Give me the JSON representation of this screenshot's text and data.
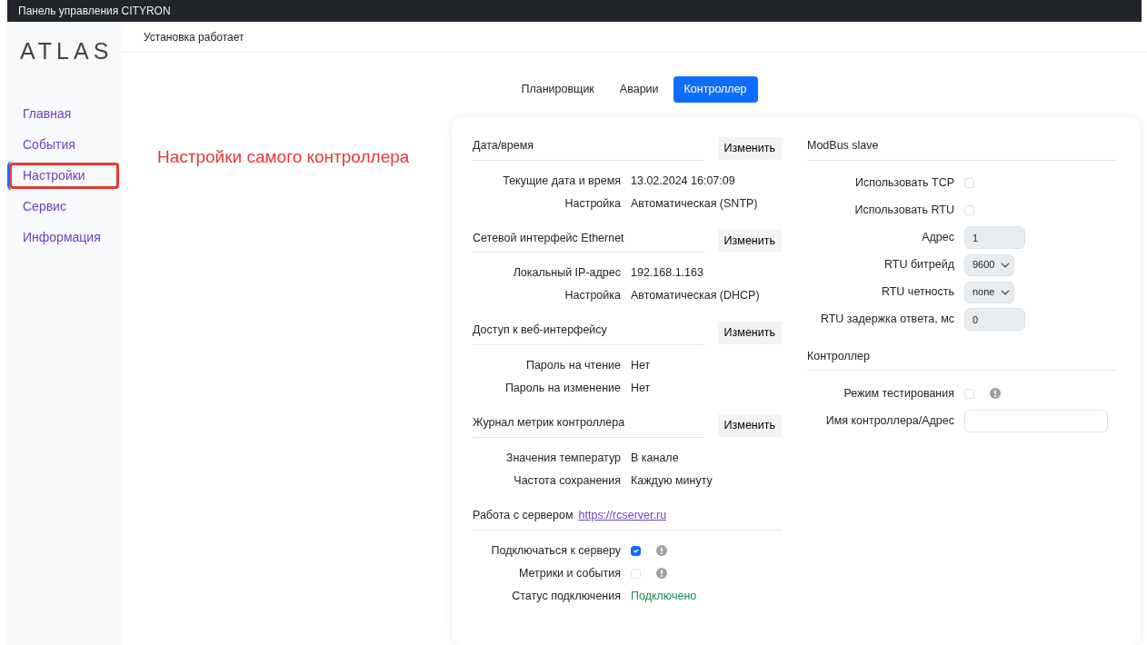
{
  "topbar": {
    "title": "Панель управления CITYRON"
  },
  "logo": "ATLAS",
  "sidebar": {
    "items": [
      {
        "label": "Главная",
        "selected": false,
        "highlighted": false
      },
      {
        "label": "События",
        "selected": false,
        "highlighted": false
      },
      {
        "label": "Настройки",
        "selected": true,
        "highlighted": true
      },
      {
        "label": "Сервис",
        "selected": false,
        "highlighted": false
      },
      {
        "label": "Информация",
        "selected": false,
        "highlighted": false
      }
    ]
  },
  "status_text": "Установка работает",
  "annotation": "Настройки самого контроллера",
  "tabs": [
    {
      "label": "Планировщик",
      "selected": false
    },
    {
      "label": "Аварии",
      "selected": false
    },
    {
      "label": "Контроллер",
      "selected": true
    }
  ],
  "left_sections": [
    {
      "title": "Дата/время",
      "button": "Изменить",
      "rows": [
        {
          "kind": "text",
          "label": "Текущие дата и время",
          "value": "13.02.2024 16:07:09"
        },
        {
          "kind": "text",
          "label": "Настройка",
          "value": "Автоматическая (SNTP)"
        }
      ]
    },
    {
      "title": "Сетевой интерфейс Ethernet",
      "button": "Изменить",
      "rows": [
        {
          "kind": "text",
          "label": "Локальный IP-адрес",
          "value": "192.168.1.163"
        },
        {
          "kind": "text",
          "label": "Настройка",
          "value": "Автоматическая (DHCP)"
        }
      ]
    },
    {
      "title": "Доступ к веб-интерфейсу",
      "button": "Изменить",
      "rows": [
        {
          "kind": "text",
          "label": "Пароль на чтение",
          "value": "Нет"
        },
        {
          "kind": "text",
          "label": "Пароль на изменение",
          "value": "Нет"
        }
      ]
    },
    {
      "title": "Журнал метрик контроллера",
      "button": "Изменить",
      "rows": [
        {
          "kind": "text",
          "label": "Значения температур",
          "value": "В канале"
        },
        {
          "kind": "text",
          "label": "Частота сохранения",
          "value": "Каждую минуту"
        }
      ]
    },
    {
      "title": "Работа с сервером",
      "link": "https://rcserver.ru",
      "rows": [
        {
          "kind": "checkbox",
          "label": "Подключаться к серверу",
          "checked": true,
          "info": true
        },
        {
          "kind": "checkbox",
          "label": "Метрики и события",
          "checked": false,
          "info": true
        },
        {
          "kind": "status",
          "label": "Статус подключения",
          "value": "Подключено"
        }
      ]
    }
  ],
  "right_sections": [
    {
      "title": "ModBus slave",
      "rows": [
        {
          "kind": "checkbox",
          "label": "Использовать TCP",
          "checked": false,
          "info": false
        },
        {
          "kind": "checkbox",
          "label": "Использовать RTU",
          "checked": false,
          "info": false
        },
        {
          "kind": "input",
          "label": "Адрес",
          "value": "1",
          "disabled": true
        },
        {
          "kind": "select",
          "label": "RTU битрейд",
          "value": "9600",
          "disabled": true
        },
        {
          "kind": "select",
          "label": "RTU четность",
          "value": "none",
          "disabled": true
        },
        {
          "kind": "input",
          "label": "RTU задержка ответа, мс",
          "value": "0",
          "disabled": true
        }
      ]
    },
    {
      "title": "Контроллер",
      "rows": [
        {
          "kind": "checkbox",
          "label": "Режим тестирования",
          "checked": false,
          "info": true
        },
        {
          "kind": "textbox",
          "label": "Имя контроллера/Адрес",
          "disabled": false
        }
      ]
    }
  ]
}
